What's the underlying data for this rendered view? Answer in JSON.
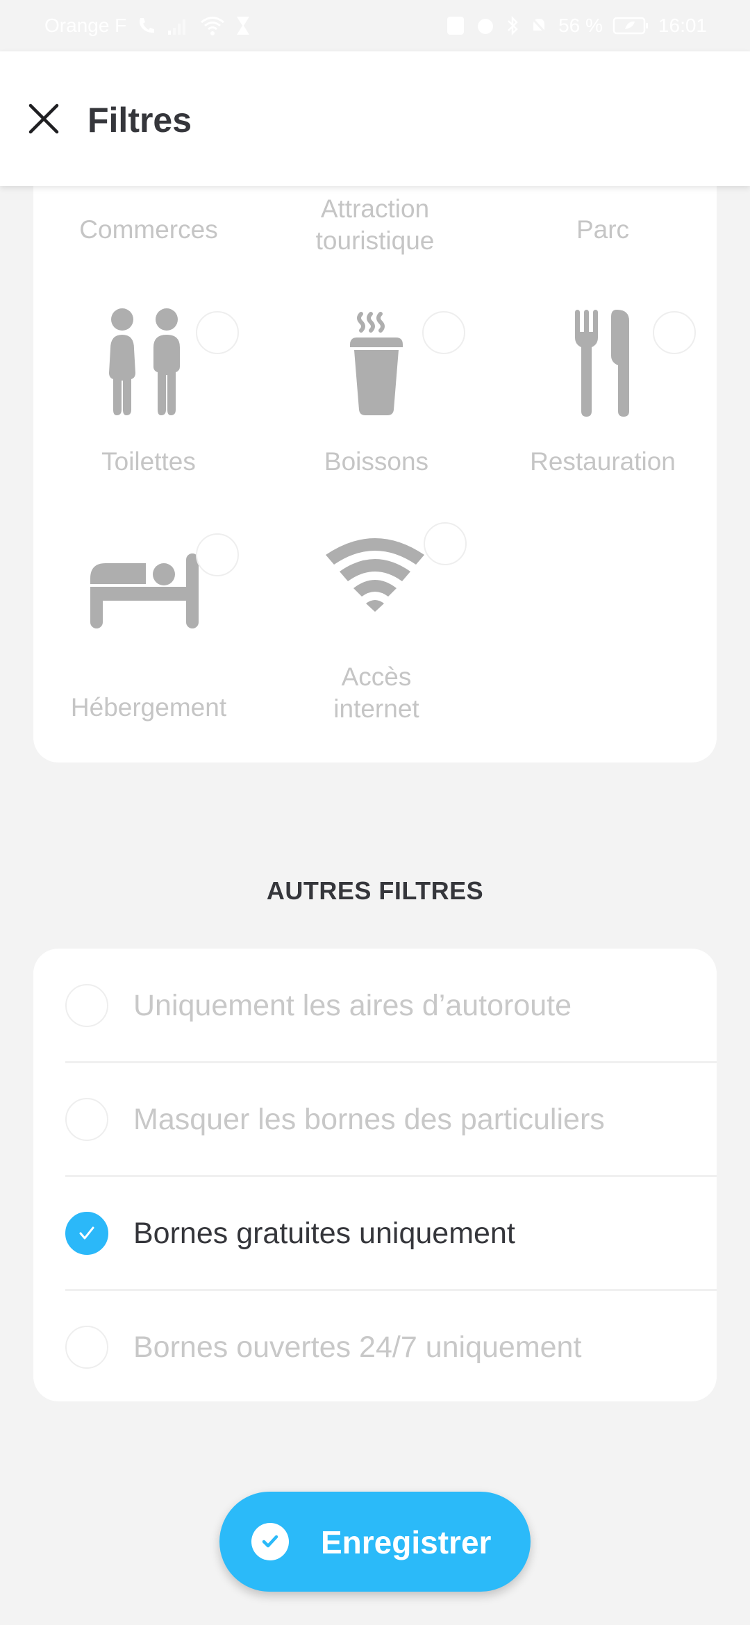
{
  "status_bar": {
    "carrier": "Orange F",
    "battery_percent": "56 %",
    "time": "16:01",
    "icons_left": [
      "wifi-calling-icon",
      "signal-icon",
      "wifi-icon",
      "hourglass-icon"
    ],
    "icons_right": [
      "nfc-icon",
      "alarm-icon",
      "bluetooth-icon",
      "bell-off-icon",
      "battery-saver-icon"
    ]
  },
  "header": {
    "title": "Filtres",
    "close_icon": "close-icon"
  },
  "amenities": {
    "top_row_labels": [
      "Commerces",
      "Attraction touristique",
      "Parc"
    ],
    "items": [
      {
        "label": "Toilettes",
        "icon": "toilets-icon",
        "selected": false
      },
      {
        "label": "Boissons",
        "icon": "hot-drink-icon",
        "selected": false
      },
      {
        "label": "Restauration",
        "icon": "fork-knife-icon",
        "selected": false
      },
      {
        "label": "Hébergement",
        "icon": "bed-icon",
        "selected": false
      },
      {
        "label": "Accès internet",
        "icon": "wifi-icon",
        "selected": false
      }
    ]
  },
  "other_filters": {
    "title": "AUTRES FILTRES",
    "items": [
      {
        "label": "Uniquement les aires d’autoroute",
        "checked": false
      },
      {
        "label": "Masquer les bornes des particuliers",
        "checked": false
      },
      {
        "label": "Bornes gratuites uniquement",
        "checked": true
      },
      {
        "label": "Bornes ouvertes 24/7 uniquement",
        "checked": false
      }
    ]
  },
  "save_button": {
    "label": "Enregistrer",
    "icon": "check-circle-icon"
  },
  "colors": {
    "accent": "#2bbaf9",
    "title_text": "#35363b",
    "inactive_text": "#c5c5c5",
    "icon_gray": "#aeaeae",
    "background": "#f3f3f3"
  }
}
